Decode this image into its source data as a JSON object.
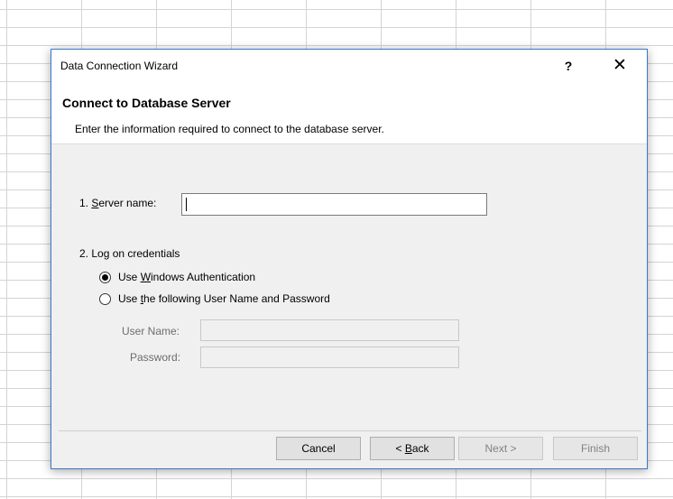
{
  "dialog": {
    "title": "Data Connection Wizard",
    "help_label": "?",
    "close_label": "✕"
  },
  "header": {
    "title": "Connect to Database Server",
    "subtitle": "Enter the information required to connect to the database server."
  },
  "form": {
    "server_label_prefix": "1. ",
    "server_label_mnemonic": "S",
    "server_label_rest": "erver name:",
    "server_value": "",
    "credentials_label": "2. Log on credentials",
    "option_windows": {
      "prefix": "Use ",
      "mnemonic": "W",
      "rest": "indows Authentication",
      "selected": true
    },
    "option_userpass": {
      "prefix": "Use ",
      "mnemonic": "t",
      "rest": "he following User Name and Password",
      "selected": false
    },
    "username_label": "User Name:",
    "username_value": "",
    "password_label": "Password:",
    "password_value": ""
  },
  "buttons": {
    "cancel": "Cancel",
    "back_prefix": "< ",
    "back_mnemonic": "B",
    "back_rest": "ack",
    "next": "Next >",
    "finish": "Finish"
  }
}
